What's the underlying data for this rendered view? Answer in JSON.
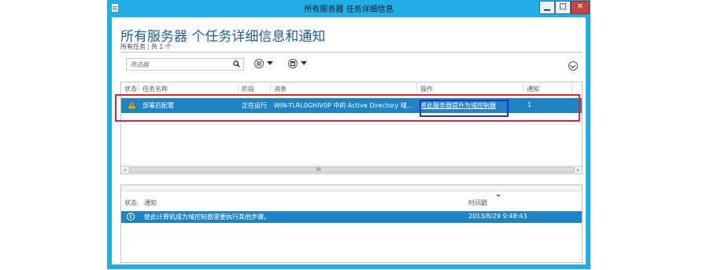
{
  "window": {
    "title": "所有服务器 任务详细信息",
    "controls": {
      "minimize": "▁",
      "maximize": "□",
      "close": "✕"
    }
  },
  "page": {
    "title": "所有服务器 个任务详细信息和通知",
    "tasks_label": "所有任务",
    "tasks_count": "共 1 个"
  },
  "toolbar": {
    "filter_placeholder": "筛选器",
    "icons": [
      "search-icon",
      "list-options-icon",
      "save-icon",
      "collapse-icon"
    ]
  },
  "tasks_table": {
    "columns": [
      "状态",
      "任务名称",
      "阶段",
      "消息",
      "操作",
      "通知"
    ],
    "rows": [
      {
        "status_icon": "warning-icon",
        "name": "部署后配置",
        "stage": "正在运行",
        "message": "WIN-TLRL0GHIV0P 中的 Active Directory 域...",
        "action": "将此服务器提升为域控制器",
        "notifications": "1"
      }
    ],
    "scroll_grip": "III"
  },
  "notifications_table": {
    "columns": [
      "状态",
      "通知",
      "时间戳"
    ],
    "rows": [
      {
        "status_icon": "info-icon",
        "notification": "使此计算机成为域控制器需要执行其他步骤。",
        "timestamp": "2013/8/29 9:48:43"
      }
    ]
  },
  "colors": {
    "window_frame": "#1faee6",
    "selection": "#1f84c5",
    "title_text": "#1d5f93",
    "highlight_red": "#e0242c",
    "highlight_blue": "#1a35d6",
    "close_button": "#c7463c"
  }
}
